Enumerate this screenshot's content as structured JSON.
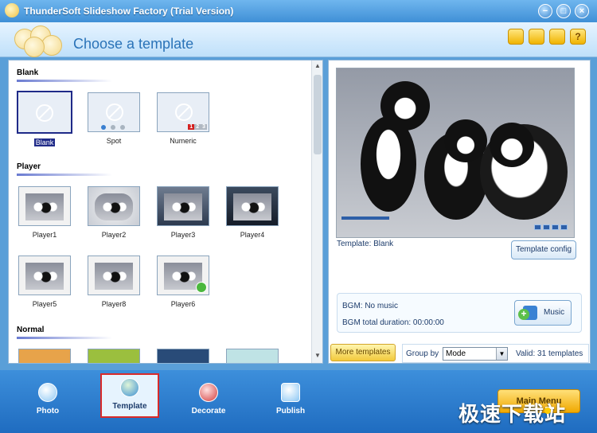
{
  "window": {
    "title": "ThunderSoft Slideshow Factory (Trial Version)",
    "buttons": [
      "−",
      "□",
      "×"
    ]
  },
  "header": {
    "title": "Choose a template",
    "icons": [
      "folder-icon",
      "note-icon",
      "person-icon",
      "help-icon"
    ],
    "help_glyph": "?"
  },
  "sections": {
    "blank": "Blank",
    "player": "Player",
    "normal": "Normal"
  },
  "templates": {
    "blank": [
      {
        "label": "Blank"
      },
      {
        "label": "Spot"
      },
      {
        "label": "Numeric",
        "badges": [
          "1",
          "2",
          "3"
        ]
      }
    ],
    "player": [
      {
        "label": "Player1"
      },
      {
        "label": "Player2"
      },
      {
        "label": "Player3"
      },
      {
        "label": "Player4"
      },
      {
        "label": "Player5"
      },
      {
        "label": "Player8"
      },
      {
        "label": "Player6"
      }
    ]
  },
  "preview": {
    "template_label": "Template:  Blank",
    "template_config": "Template config",
    "bgm": "BGM: No music",
    "bgm_duration": "BGM total duration: 00:00:00",
    "music": "Music"
  },
  "bottom_strip": {
    "more_templates": "More templates",
    "group_by_label": "Group by",
    "group_by_value": "Mode",
    "valid": "Valid: 31 templates"
  },
  "nav": {
    "tabs": [
      "Photo",
      "Template",
      "Decorate",
      "Publish"
    ],
    "active": "Template",
    "main_menu": "Main Menu"
  },
  "watermark": {
    "text": "极速下载站"
  },
  "colors": {
    "accent": "#2a73b8",
    "selected": "#1f2a88",
    "highlight_border": "#d92a2a"
  }
}
